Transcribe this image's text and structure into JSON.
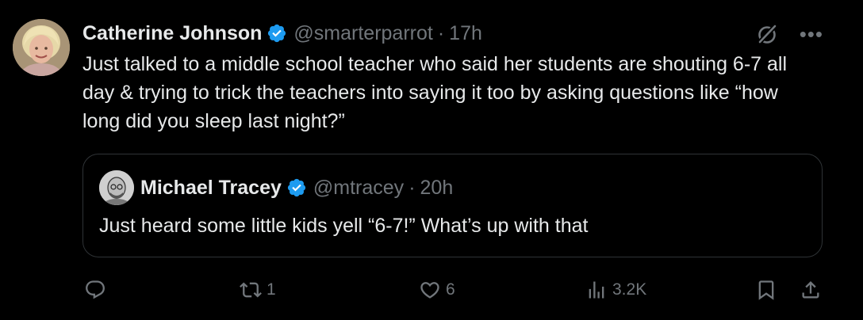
{
  "tweet": {
    "author_name": "Catherine Johnson",
    "handle": "@smarterparrot",
    "separator": "·",
    "time": "17h",
    "text": "Just talked to a middle school teacher who said her students are shouting 6-7 all day & trying to trick the teachers into saying it too by asking questions like “how long did you sleep last night?”",
    "replies": "",
    "retweets": "1",
    "likes": "6",
    "views": "3.2K"
  },
  "quoted": {
    "author_name": "Michael Tracey",
    "handle": "@mtracey",
    "separator": "·",
    "time": "20h",
    "text": "Just heard some little kids yell “6-7!” What’s up with that"
  },
  "colors": {
    "background": "#000000",
    "primary_text": "#e7e9ea",
    "secondary_text": "#71767b",
    "verified_badge": "#1d9bf0",
    "border": "#2f3336"
  },
  "icons": {
    "verified": "verified-badge-icon",
    "grok": "grok-icon",
    "more": "more-icon",
    "reply": "reply-icon",
    "retweet": "retweet-icon",
    "like": "heart-icon",
    "views": "views-icon",
    "bookmark": "bookmark-icon",
    "share": "share-icon"
  }
}
